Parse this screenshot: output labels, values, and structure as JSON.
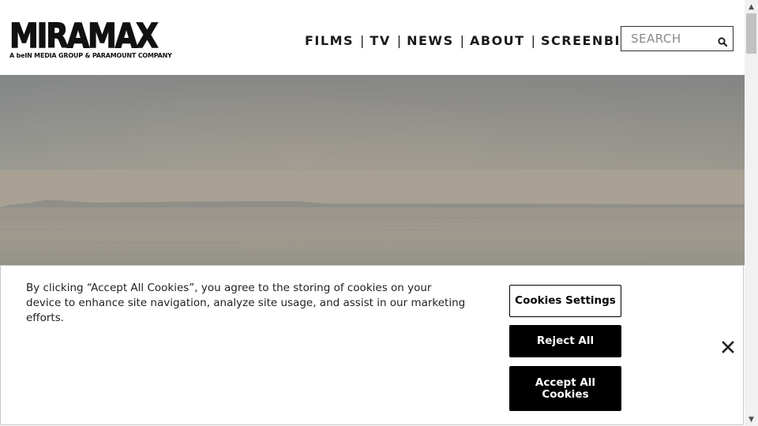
{
  "header": {
    "logo": {
      "wordmark": "MIRAMAX",
      "tagline": "A beIN MEDIA GROUP & PARAMOUNT COMPANY"
    },
    "nav": {
      "items": [
        {
          "label": "FILMS"
        },
        {
          "label": "TV"
        },
        {
          "label": "NEWS"
        },
        {
          "label": "ABOUT"
        },
        {
          "label": "SCREENBID"
        }
      ],
      "separator": "|"
    },
    "search": {
      "placeholder": "SEARCH",
      "icon": "search-icon"
    }
  },
  "hero": {
    "image": "misty-sea-landscape"
  },
  "cookie_banner": {
    "text": "By clicking “Accept All Cookies”, you agree to the storing of cookies on your device to enhance site navigation, analyze site usage, and assist in our marketing efforts.",
    "settings_label": "Cookies Settings",
    "reject_label": "Reject All",
    "accept_label": "Accept All Cookies",
    "close_icon": "close-icon"
  },
  "colors": {
    "text": "#1a1a1a",
    "button_dark": "#000000",
    "button_light": "#ffffff",
    "hero_sky": "#8a8884",
    "hero_sea": "#99958b"
  }
}
